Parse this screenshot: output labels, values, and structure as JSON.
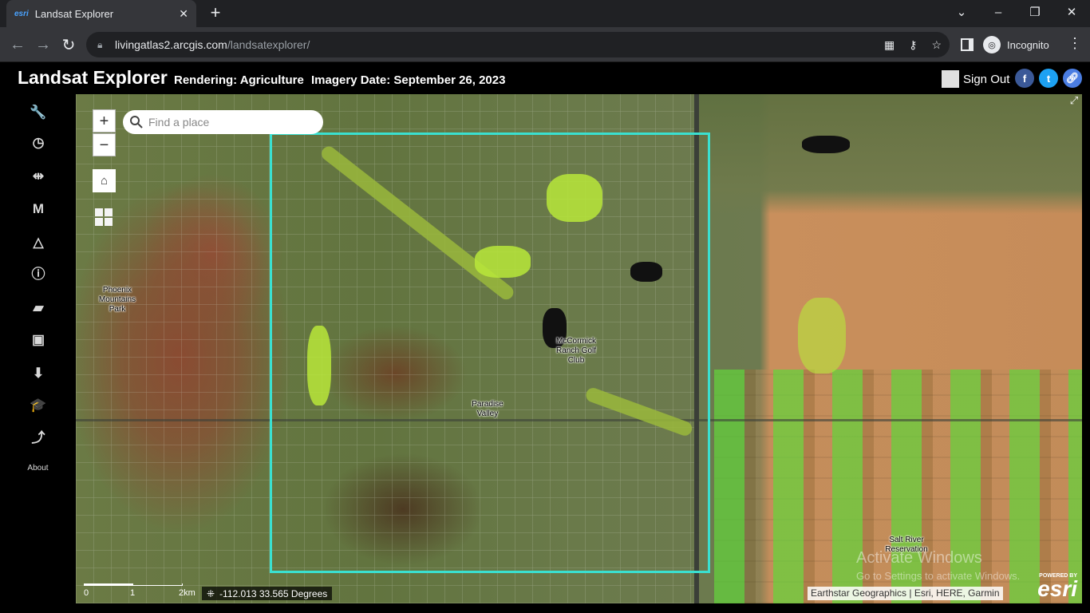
{
  "browser": {
    "tab_title": "Landsat Explorer",
    "tab_favicon": "esri",
    "url_host": "livingatlas2.arcgis.com",
    "url_path": "/landsatexplorer/",
    "profile_label": "Incognito"
  },
  "header": {
    "app_title": "Landsat Explorer",
    "rendering": "Rendering: Agriculture",
    "imagery_date": "Imagery Date: September 26, 2023",
    "sign_out": "Sign Out"
  },
  "rail": {
    "items": [
      {
        "icon": "wrench-icon",
        "glyph": "🔧"
      },
      {
        "icon": "clock-icon",
        "glyph": "◷"
      },
      {
        "icon": "swipe-icon",
        "glyph": "⇹"
      },
      {
        "icon": "m-icon",
        "glyph": "M"
      },
      {
        "icon": "triangle-icon",
        "glyph": "△"
      },
      {
        "icon": "info-icon",
        "glyph": "ⓘ"
      },
      {
        "icon": "book-icon",
        "glyph": "▰"
      },
      {
        "icon": "save-icon",
        "glyph": "▣"
      },
      {
        "icon": "download-icon",
        "glyph": "⬇"
      },
      {
        "icon": "graduation-cap-icon",
        "glyph": "🎓"
      },
      {
        "icon": "esri-logo-icon",
        "glyph": "⤴"
      }
    ],
    "about": "About"
  },
  "map": {
    "search_placeholder": "Find a place",
    "zoom_in": "+",
    "zoom_out": "−",
    "labels": {
      "phoenix": "Phoenix Mountains Park",
      "mccormick": "McCormick Ranch Golf Club",
      "paradise": "Paradise Valley",
      "salt_river": "Salt River Reservation"
    },
    "scale": {
      "t0": "0",
      "t1": "1",
      "t2": "2km"
    },
    "coordinates": "-112.013 33.565 Degrees",
    "attribution": "Earthstar Geographics | Esri, HERE, Garmin",
    "powered_by": "POWERED BY",
    "esri_logo": "esri",
    "watermark_title": "Activate Windows",
    "watermark_sub": "Go to Settings to activate Windows."
  },
  "colors": {
    "aoi_outline": "#3ae0d0",
    "facebook": "#3b5998",
    "twitter": "#1da1f2",
    "link": "#4a7de2"
  }
}
